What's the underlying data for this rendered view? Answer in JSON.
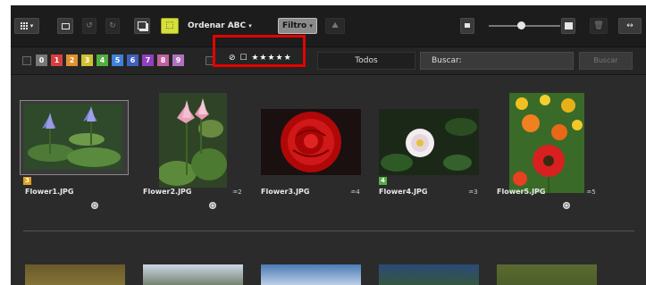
{
  "toolbar": {
    "sort_label": "Ordenar ABC",
    "filter_label": "Filtro",
    "slider_value": 0.45,
    "icons": [
      "grid-view-icon",
      "single-view-icon",
      "rotate-left-icon",
      "rotate-right-icon",
      "compare-icon",
      "select-icon",
      "dropdown-arrow-icon",
      "upload-icon",
      "small-thumb-icon",
      "large-thumb-icon",
      "trash-icon",
      "swap-icon"
    ]
  },
  "filterbar": {
    "labels": [
      "0",
      "1",
      "2",
      "3",
      "4",
      "5",
      "6",
      "7",
      "8",
      "9"
    ],
    "label_colors": [
      "#777777",
      "#d84040",
      "#e09030",
      "#d0c030",
      "#50b040",
      "#4080d8",
      "#4060c0",
      "#9040c0",
      "#c060a0",
      "#b070c0"
    ],
    "rating_filter": "⊘ ☐ ★★★★★",
    "rating_all": "Todos",
    "search_label": "Buscar:",
    "search_button": "Buscar"
  },
  "photos": [
    {
      "name": "Flower1.JPG",
      "number": "",
      "label": "3",
      "label_color": "#e0a020",
      "selected": true
    },
    {
      "name": "Flower2.JPG",
      "number": "♒2",
      "label": "",
      "label_color": "",
      "selected": false
    },
    {
      "name": "Flower3.JPG",
      "number": "♒4",
      "label": "",
      "label_color": "",
      "selected": false
    },
    {
      "name": "Flower4.JPG",
      "number": "♒3",
      "label": "4",
      "label_color": "#50b040",
      "selected": false
    },
    {
      "name": "Flower5.JPG",
      "number": "♒5",
      "label": "",
      "label_color": "",
      "selected": false
    }
  ],
  "colors": {
    "highlight": "#e60000",
    "background": "#2b2b2b",
    "toolbar": "#1c1c1c"
  }
}
